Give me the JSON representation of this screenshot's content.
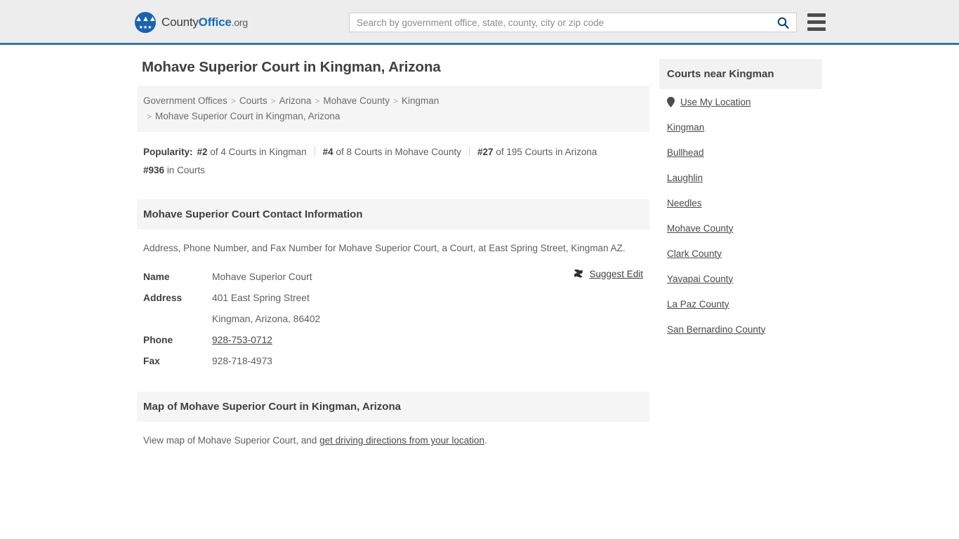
{
  "header": {
    "brand": {
      "prefix": "County",
      "accent": "Office",
      "tld": ".org",
      "logo_icon": "eagle-seal-icon"
    },
    "search": {
      "placeholder": "Search by government office, state, county, city or zip code",
      "value": "",
      "search_icon": "search-icon"
    },
    "menu_icon": "hamburger-menu-icon"
  },
  "main": {
    "title": "Mohave Superior Court in Kingman, Arizona",
    "breadcrumb": {
      "separator": ">",
      "items": [
        "Government Offices",
        "Courts",
        "Arizona",
        "Mohave County",
        "Kingman"
      ],
      "current": "Mohave Superior Court in Kingman, Arizona"
    },
    "popularity": {
      "label": "Popularity:",
      "items": [
        {
          "rank": "#2",
          "text": "of 4 Courts in Kingman"
        },
        {
          "rank": "#4",
          "text": "of 8 Courts in Mohave County"
        },
        {
          "rank": "#27",
          "text": "of 195 Courts in Arizona"
        },
        {
          "rank": "#936",
          "text": "in Courts"
        }
      ]
    },
    "contact_section": {
      "heading": "Mohave Superior Court Contact Information",
      "description": "Address, Phone Number, and Fax Number for Mohave Superior Court, a Court, at East Spring Street, Kingman AZ.",
      "suggest_edit": {
        "label": "Suggest Edit",
        "icon": "edit-suggest-icon"
      },
      "rows": [
        {
          "label": "Name",
          "value": "Mohave Superior Court"
        },
        {
          "label": "Address",
          "value": "401 East Spring Street"
        },
        {
          "label": "",
          "value": "Kingman, Arizona, 86402"
        },
        {
          "label": "Phone",
          "value": "928-753-0712"
        },
        {
          "label": "Fax",
          "value": "928-718-4973"
        }
      ]
    },
    "map_section": {
      "heading": "Map of Mohave Superior Court in Kingman, Arizona",
      "text_before": "View map of Mohave Superior Court, and ",
      "link_text": "get driving directions from your location",
      "text_after": "."
    }
  },
  "sidebar": {
    "heading": "Courts near Kingman",
    "use_my_location": {
      "label": "Use My Location",
      "icon": "map-pin-icon"
    },
    "items": [
      "Kingman",
      "Bullhead",
      "Laughlin",
      "Needles",
      "Mohave County",
      "Clark County",
      "Yavapai County",
      "La Paz County",
      "San Bernardino County"
    ]
  },
  "colors": {
    "header_bg": "#ededed",
    "header_rule": "#3a75a8",
    "brand_accent": "#1a6bb5",
    "panel_bg": "#f5f5f5",
    "text": "#4a4a4a"
  }
}
